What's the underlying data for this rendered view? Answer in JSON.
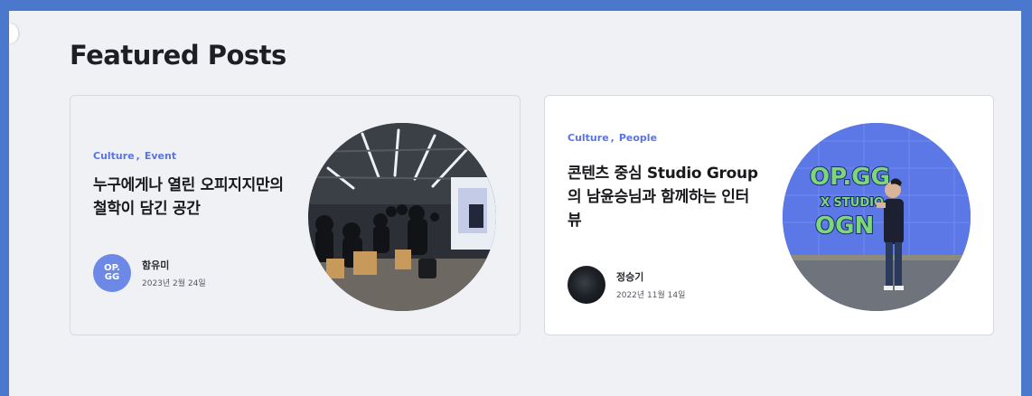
{
  "page": {
    "heading": "Featured Posts"
  },
  "posts": [
    {
      "categories": [
        "Culture",
        "Event"
      ],
      "separator": ",",
      "title": "누구에게나 열린 오피지지만의 철학이 담긴 공간",
      "author": "함유미",
      "date": "2023년 2월 24일",
      "avatar": "opgg-logo",
      "avatar_text": [
        "OP.",
        "GG"
      ]
    },
    {
      "categories": [
        "Culture",
        "People"
      ],
      "separator": ",",
      "title": "콘텐츠 중심 Studio Group의 남윤승님과 함께하는 인터뷰",
      "author": "정승기",
      "date": "2022년 11월 14일",
      "avatar": "profile-photo",
      "photo_sign": [
        "OP.GG",
        "X STUDIO",
        "OGN"
      ]
    }
  ],
  "colors": {
    "outer_frame": "#4a78cc",
    "page_background": "#eff1f5",
    "category_accent": "#5b74e0",
    "logo_avatar": "#6c89e8"
  }
}
